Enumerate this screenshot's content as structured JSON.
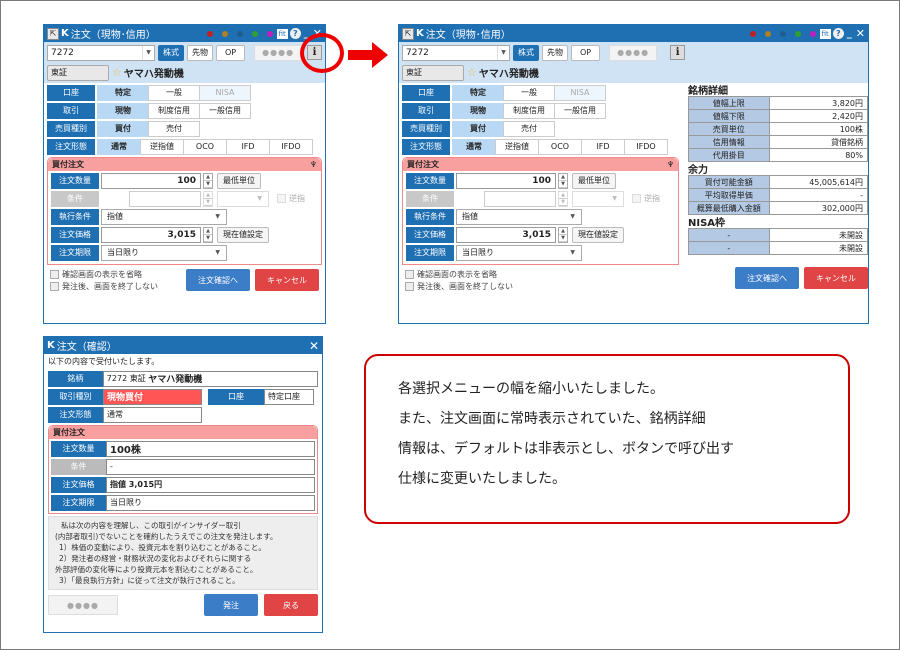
{
  "order_window": {
    "title": "注文（現物･信用）",
    "symbol_code": "7272",
    "product_tabs": [
      "株式",
      "先物",
      "OP"
    ],
    "password_placeholder": "●●●●",
    "info_button": "i",
    "market": "東証",
    "stock_name": "ヤマハ発動機",
    "rows": {
      "account": {
        "label": "口座",
        "options": [
          "特定",
          "一般",
          "NISA"
        ],
        "selected": "特定"
      },
      "trade": {
        "label": "取引",
        "options": [
          "現物",
          "制度信用",
          "一般信用"
        ],
        "selected": "現物"
      },
      "side": {
        "label": "売買種別",
        "options": [
          "買付",
          "売付"
        ],
        "selected": "買付"
      },
      "order_type": {
        "label": "注文形態",
        "options": [
          "通常",
          "逆指値",
          "OCO",
          "IFD",
          "IFDO"
        ],
        "selected": "通常"
      }
    },
    "order_section": {
      "title": "買付注文",
      "quantity_label": "注文数量",
      "quantity": "100",
      "min_unit_button": "最低単位",
      "condition_label": "条件",
      "stop_checkbox": "逆指",
      "exec_label": "執行条件",
      "exec_value": "指値",
      "price_label": "注文価格",
      "price": "3,015",
      "current_price_button": "現在値設定",
      "expiry_label": "注文期限",
      "expiry_value": "当日限り"
    },
    "checkboxes": [
      "確認画面の表示を省略",
      "発注後、画面を終了しない"
    ],
    "confirm_button": "注文確認へ",
    "cancel_button": "キャンセル"
  },
  "details": {
    "stock_title": "銘柄詳細",
    "stock_rows": [
      {
        "k": "値幅上限",
        "v": "3,820円"
      },
      {
        "k": "値幅下限",
        "v": "2,420円"
      },
      {
        "k": "売買単位",
        "v": "100株"
      },
      {
        "k": "信用情報",
        "v": "貸借銘柄"
      },
      {
        "k": "代用掛目",
        "v": "80%"
      }
    ],
    "margin_title": "余力",
    "margin_rows": [
      {
        "k": "買付可能金額",
        "v": "45,005,614円"
      },
      {
        "k": "平均取得単価",
        "v": "-"
      },
      {
        "k": "概算最低購入金額",
        "v": "302,000円"
      }
    ],
    "nisa_title": "NISA枠",
    "nisa_rows": [
      {
        "k": "-",
        "v": "未開設"
      },
      {
        "k": "-",
        "v": "未開設"
      }
    ]
  },
  "confirm_window": {
    "title": "注文（確認）",
    "intro": "以下の内容で受付いたします。",
    "stock_label": "銘柄",
    "stock_value_prefix": "7272 東証",
    "stock_value_name": "ヤマハ発動機",
    "trade_label": "取引種別",
    "trade_value": "現物買付",
    "account_label": "口座",
    "account_value": "特定口座",
    "type_label": "注文形態",
    "type_value": "通常",
    "section_title": "買付注文",
    "qty_label": "注文数量",
    "qty_value": "100株",
    "cond_label": "条件",
    "cond_value": "-",
    "price_label": "注文価格",
    "price_value": "指値 3,015円",
    "expiry_label": "注文期限",
    "expiry_value": "当日限り",
    "disclaimer": [
      "私は次の内容を理解し、この取引がインサイダー取引",
      "(内部者取引)でないことを確約したうえでこの注文を発注します。",
      "1）株価の変動により、投資元本を割り込むことがあること。",
      "2）発注者の経営・財務状況の変化およびそれらに関する",
      "外部評価の変化等により投資元本を割込むことがあること。",
      "3）「最良執行方針」に従って注文が執行されること。"
    ],
    "password_placeholder": "●●●●",
    "submit_button": "発注",
    "back_button": "戻る"
  },
  "note": {
    "lines": [
      "各選択メニューの幅を縮小いたしました。",
      "また、注文画面に常時表示されていた、銘柄詳細",
      "情報は、デフォルトは非表示とし、ボタンで呼び出す",
      "仕様に変更いたしました。"
    ]
  },
  "colors": {
    "accent": "#1f6fb3",
    "highlight": "#e00000",
    "dots": [
      "#c02020",
      "#b08020",
      "#1f5f8f",
      "#30a030",
      "#c020c0"
    ]
  }
}
